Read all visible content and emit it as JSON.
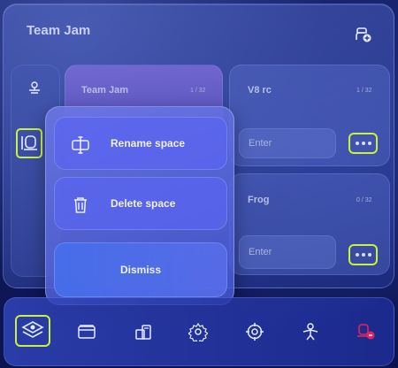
{
  "header": {
    "title": "Team Jam"
  },
  "cards": [
    {
      "title": "Team Jam",
      "count": "1 / 32"
    },
    {
      "title": "V8 rc",
      "count": "1 / 32",
      "input_placeholder": "Enter"
    },
    {
      "title": "Frog",
      "count": "0 / 32",
      "input_placeholder": "Enter"
    }
  ],
  "context_menu": {
    "rename_label": "Rename space",
    "delete_label": "Delete space",
    "dismiss_label": "Dismiss"
  },
  "bottom_nav": {
    "items": [
      "spaces-icon",
      "wallet-icon",
      "inventory-icon",
      "settings-icon",
      "target-icon",
      "avatar-icon",
      "notifications-icon"
    ]
  },
  "colors": {
    "focus_ring": "#c9f23a",
    "alert": "#e0245e"
  }
}
